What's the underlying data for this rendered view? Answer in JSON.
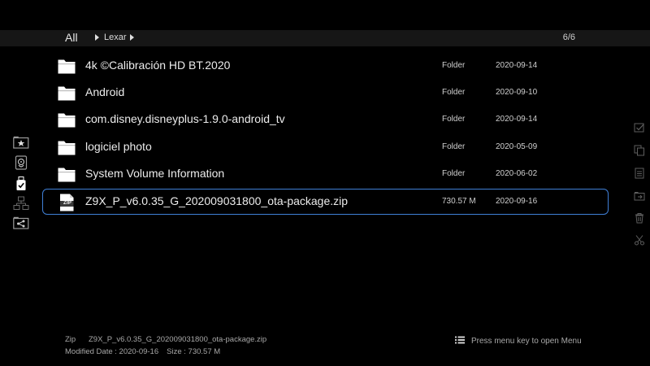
{
  "header": {
    "root_label": "All",
    "breadcrumb": "Lexar",
    "count": "6/6"
  },
  "left_sidebar": [
    {
      "icon": "favorites-folder-icon"
    },
    {
      "icon": "media-source-icon"
    },
    {
      "icon": "usb-drive-icon",
      "selected": true
    },
    {
      "icon": "network-icon"
    },
    {
      "icon": "share-folder-icon"
    }
  ],
  "right_sidebar": [
    {
      "icon": "select-icon"
    },
    {
      "icon": "copy-icon"
    },
    {
      "icon": "paste-icon"
    },
    {
      "icon": "move-folder-icon"
    },
    {
      "icon": "delete-icon"
    },
    {
      "icon": "cut-icon"
    }
  ],
  "files": [
    {
      "name": "4k ©Calibración HD BT.2020",
      "size": "Folder",
      "date": "2020-09-14",
      "type": "folder"
    },
    {
      "name": "Android",
      "size": "Folder",
      "date": "2020-09-10",
      "type": "folder"
    },
    {
      "name": "com.disney.disneyplus-1.9.0-android_tv",
      "size": "Folder",
      "date": "2020-09-14",
      "type": "folder"
    },
    {
      "name": "logiciel photo",
      "size": "Folder",
      "date": "2020-05-09",
      "type": "folder"
    },
    {
      "name": "System Volume Information",
      "size": "Folder",
      "date": "2020-06-02",
      "type": "folder"
    },
    {
      "name": "Z9X_P_v6.0.35_G_202009031800_ota-package.zip",
      "size": "730.57 M",
      "date": "2020-09-16",
      "type": "zip",
      "icon_label": "ZIP",
      "selected": true
    }
  ],
  "footer": {
    "type": "Zip",
    "filename": "Z9X_P_v6.0.35_G_202009031800_ota-package.zip",
    "modified": "Modified Date : 2020-09-16",
    "size": "Size : 730.57 M",
    "menu_hint": "Press menu key to open Menu"
  },
  "colors": {
    "background": "#000000",
    "header_bar": "#161616",
    "selection_border": "#3f7fd6"
  }
}
